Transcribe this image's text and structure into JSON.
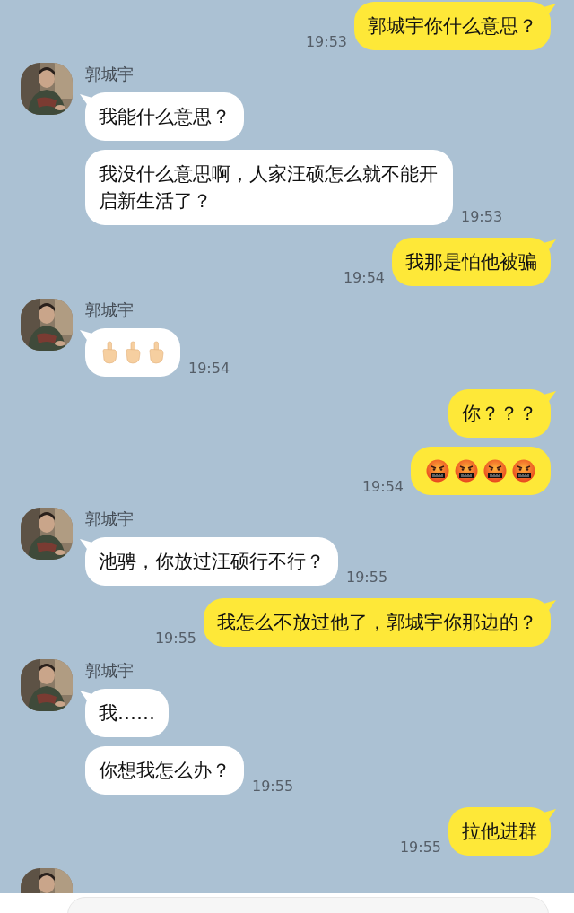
{
  "messages": [
    {
      "kind": "outgoing",
      "items": [
        {
          "kind": "text",
          "text": "郭城宇你什么意思？"
        }
      ],
      "time": "19:53"
    },
    {
      "kind": "incoming",
      "sender": "郭城宇",
      "items": [
        {
          "kind": "text",
          "text": "我能什么意思？"
        },
        {
          "kind": "text",
          "text": "我没什么意思啊，人家汪硕怎么就不能开启新生活了？"
        }
      ],
      "time": "19:53"
    },
    {
      "kind": "outgoing",
      "items": [
        {
          "kind": "text",
          "text": "我那是怕他被骗"
        }
      ],
      "time": "19:54"
    },
    {
      "kind": "incoming",
      "sender": "郭城宇",
      "items": [
        {
          "kind": "emoji",
          "emojis": [
            {
              "kind": "finger"
            },
            {
              "kind": "finger"
            },
            {
              "kind": "finger"
            }
          ]
        }
      ],
      "time": "19:54"
    },
    {
      "kind": "outgoing",
      "items": [
        {
          "kind": "text",
          "text": "你？？？"
        },
        {
          "kind": "emoji",
          "emojis": [
            {
              "kind": "cursing"
            },
            {
              "kind": "cursing"
            },
            {
              "kind": "cursing"
            },
            {
              "kind": "cursing"
            }
          ]
        }
      ],
      "time": "19:54"
    },
    {
      "kind": "incoming",
      "sender": "郭城宇",
      "items": [
        {
          "kind": "text",
          "text": "池骋，你放过汪硕行不行？"
        }
      ],
      "time": "19:55"
    },
    {
      "kind": "outgoing",
      "items": [
        {
          "kind": "text",
          "text": "我怎么不放过他了，郭城宇你那边的？"
        }
      ],
      "time": "19:55"
    },
    {
      "kind": "incoming",
      "sender": "郭城宇",
      "items": [
        {
          "kind": "text",
          "text": "我……"
        },
        {
          "kind": "text",
          "text": "你想我怎么办？"
        }
      ],
      "time": "19:55"
    },
    {
      "kind": "outgoing",
      "items": [
        {
          "kind": "text",
          "text": "拉他进群"
        }
      ],
      "time": "19:55"
    },
    {
      "kind": "incoming"
    }
  ],
  "input": {
    "kind": "field"
  }
}
